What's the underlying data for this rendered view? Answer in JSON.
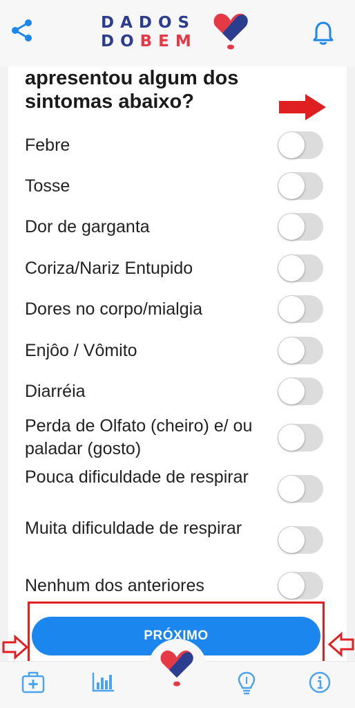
{
  "header": {
    "logo_line1": "DADOS",
    "logo_line2_blue": "DO",
    "logo_line2_red": "BEM",
    "share_icon": "share-icon",
    "bell_icon": "bell-icon"
  },
  "question": {
    "line1": "apresentou algum dos",
    "line2": "sintomas abaixo?"
  },
  "symptoms": [
    {
      "label": "Febre",
      "checked": false
    },
    {
      "label": "Tosse",
      "checked": false
    },
    {
      "label": "Dor de garganta",
      "checked": false
    },
    {
      "label": "Coriza/Nariz Entupido",
      "checked": false
    },
    {
      "label": "Dores no corpo/mialgia",
      "checked": false
    },
    {
      "label": "Enjôo / Vômito",
      "checked": false
    },
    {
      "label": "Diarréia",
      "checked": false
    },
    {
      "label": "Perda de Olfato (cheiro) e/ ou paladar (gosto)",
      "checked": false
    },
    {
      "label": "Pouca dificuldade de respirar",
      "checked": false
    },
    {
      "label": "Muita dificuldade de respirar",
      "checked": false
    },
    {
      "label": "Nenhum dos anteriores",
      "checked": false
    }
  ],
  "next_button": {
    "label": "PRÓXIMO"
  },
  "bottom_nav": [
    "medical-kit-icon",
    "bar-chart-icon",
    "heart-logo-icon",
    "lightbulb-icon",
    "info-icon"
  ],
  "colors": {
    "accent": "#1a86ee",
    "brand_blue": "#2a3d8f",
    "brand_red": "#e63946",
    "annotation_red": "#e02020",
    "toggle_off": "#dcdcdc"
  }
}
